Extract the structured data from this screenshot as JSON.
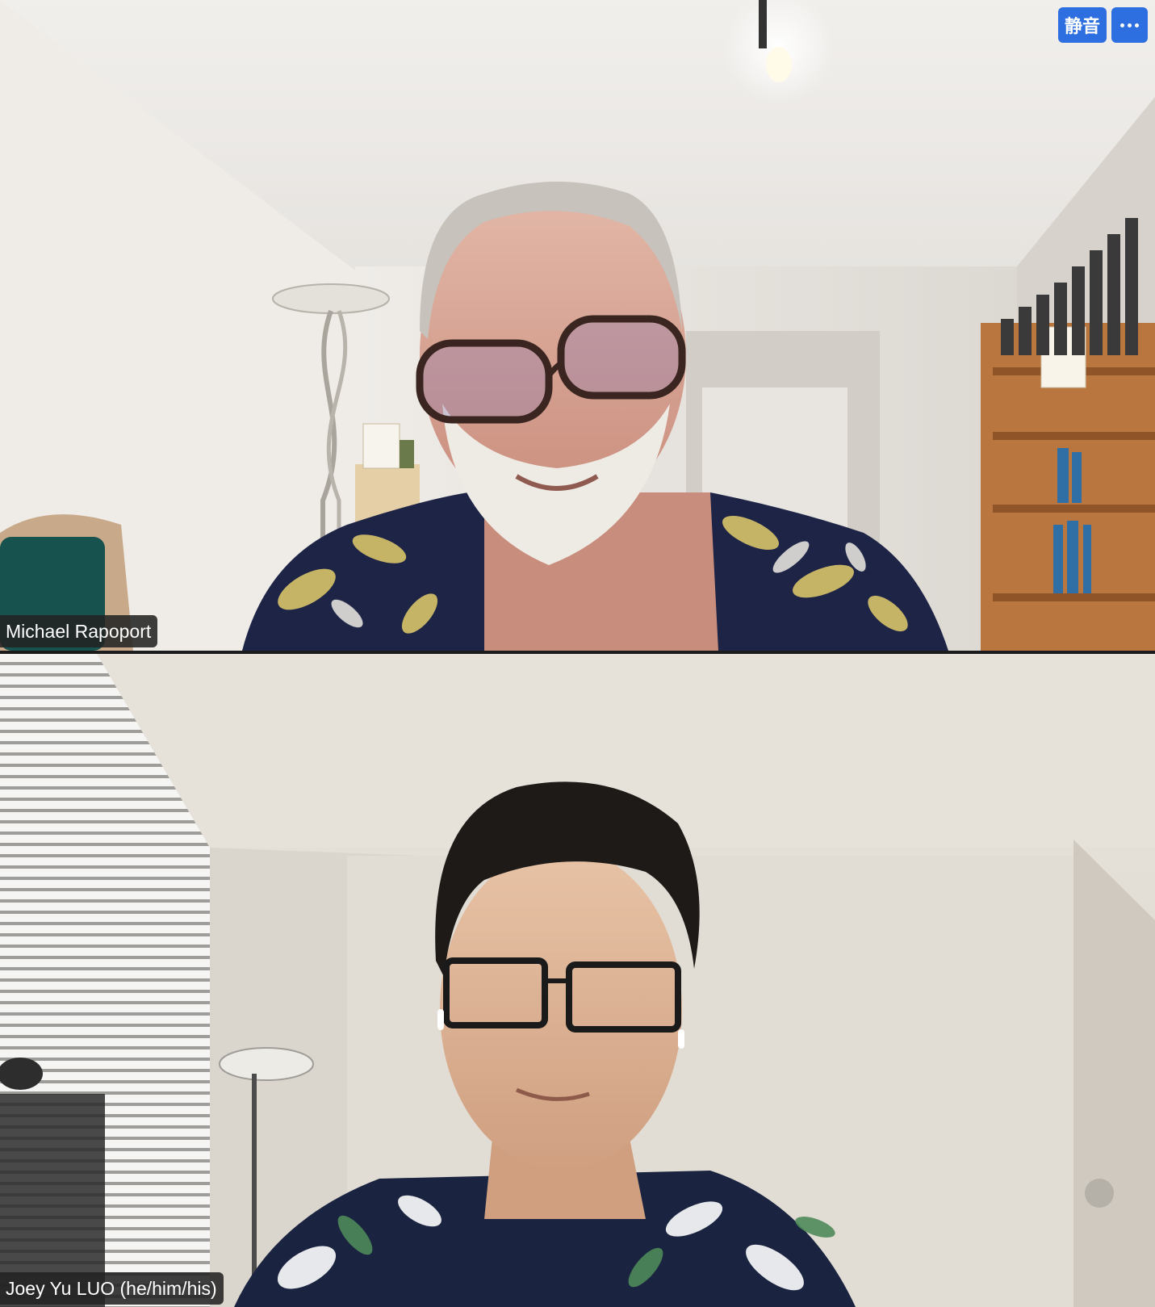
{
  "meeting": {
    "controls": {
      "mute_label": "静音",
      "more_icon": "ellipsis-icon"
    },
    "participants": [
      {
        "name": "Michael Rapoport"
      },
      {
        "name": "Joey Yu LUO (he/him/his)"
      }
    ]
  }
}
